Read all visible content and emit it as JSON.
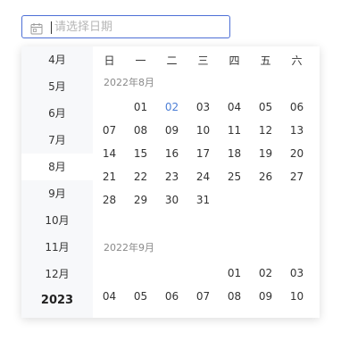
{
  "input": {
    "placeholder": "请选择日期"
  },
  "months": [
    {
      "label": "4月",
      "selected": false
    },
    {
      "label": "5月",
      "selected": false
    },
    {
      "label": "6月",
      "selected": false
    },
    {
      "label": "7月",
      "selected": false
    },
    {
      "label": "8月",
      "selected": true
    },
    {
      "label": "9月",
      "selected": false
    },
    {
      "label": "10月",
      "selected": false
    },
    {
      "label": "11月",
      "selected": false
    },
    {
      "label": "12月",
      "selected": false
    }
  ],
  "year": "2023",
  "weekdays": [
    "日",
    "一",
    "二",
    "三",
    "四",
    "五",
    "六"
  ],
  "calendar": [
    {
      "title": "2022年8月",
      "rows": [
        [
          "",
          "01",
          "02",
          "03",
          "04",
          "05",
          "06"
        ],
        [
          "07",
          "08",
          "09",
          "10",
          "11",
          "12",
          "13"
        ],
        [
          "14",
          "15",
          "16",
          "17",
          "18",
          "19",
          "20"
        ],
        [
          "21",
          "22",
          "23",
          "24",
          "25",
          "26",
          "27"
        ],
        [
          "28",
          "29",
          "30",
          "31",
          "",
          "",
          ""
        ]
      ],
      "today": "02"
    },
    {
      "title": "2022年9月",
      "rows": [
        [
          "",
          "",
          "",
          "",
          "01",
          "02",
          "03"
        ],
        [
          "04",
          "05",
          "06",
          "07",
          "08",
          "09",
          "10"
        ]
      ]
    }
  ],
  "colors": {
    "accent": "#4d6fd6",
    "today": "#4d7fd6",
    "sidebar_bg": "#f7f8fa"
  },
  "icons": {
    "input_icon": "calendar-icon"
  }
}
